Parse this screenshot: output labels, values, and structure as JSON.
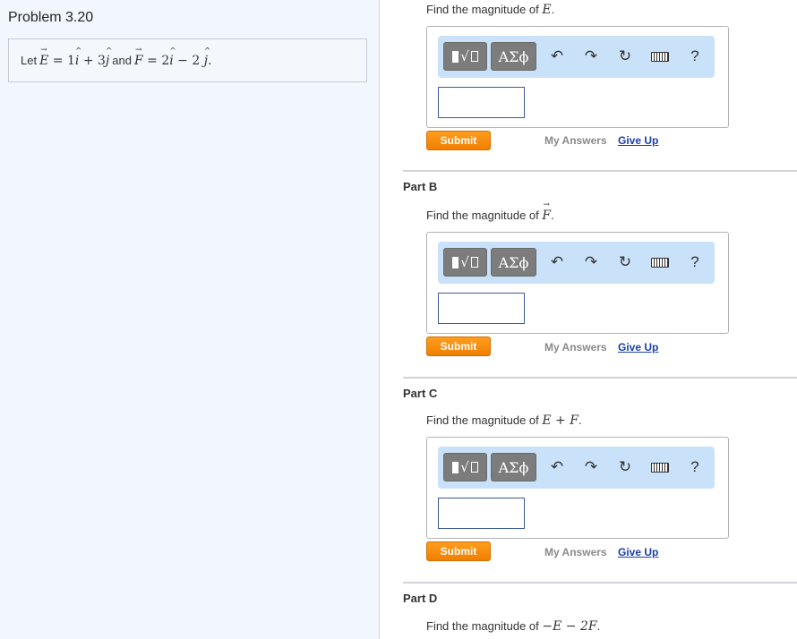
{
  "problem": {
    "title": "Problem 3.20",
    "statement": {
      "let": "Let",
      "and": "and",
      "E_vec": "E",
      "F_vec": "F",
      "eq": "=",
      "E_expr": [
        "1",
        "i",
        "+ 3",
        "j"
      ],
      "F_expr": [
        "2",
        "i",
        "− 2",
        "j"
      ],
      "period": "."
    }
  },
  "parts": [
    {
      "label": "",
      "question_prefix": "Find the magnitude of",
      "question_math": "E",
      "question_suffix": "."
    },
    {
      "label": "Part B",
      "question_prefix": "Find the magnitude of",
      "question_math": "F",
      "question_suffix": "."
    },
    {
      "label": "Part C",
      "question_prefix": "Find the magnitude of",
      "question_math": "E + F",
      "question_suffix": "."
    },
    {
      "label": "Part D",
      "question_prefix": "Find the magnitude of",
      "question_math": "−E − 2F",
      "question_suffix": "."
    }
  ],
  "toolbar": {
    "greek_label": "ΑΣϕ",
    "help_label": "?",
    "undo_icon": "undo-arrow-icon",
    "redo_icon": "redo-arrow-icon",
    "reset_icon": "reset-circular-arrow-icon",
    "keyboard_icon": "keyboard-icon",
    "templates_icon": "math-templates-icon"
  },
  "actions": {
    "submit_label": "Submit",
    "my_answers_label": "My Answers",
    "give_up_label": "Give Up"
  },
  "colors": {
    "submit_orange": "#f58a0b",
    "link_blue": "#1b3fa8",
    "toolbar_bg": "#c9e2fa",
    "left_panel_bg": "#f2f7fd"
  }
}
